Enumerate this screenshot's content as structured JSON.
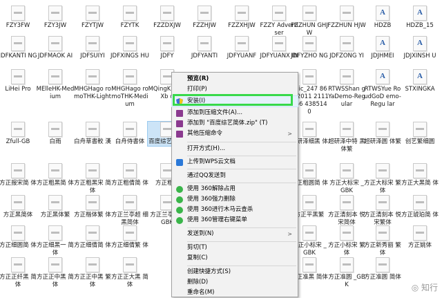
{
  "files_row1": [
    "FZY3FW",
    "FZY3JW",
    "FZYTJW",
    "FZYTK",
    "FZZDXJW",
    "FZZHJW",
    "FZZXHJW",
    "FZZY Advertiser",
    "FZZHUN GHJW",
    "FZZHUN HJW",
    "HDZB",
    "HDZB_15",
    ""
  ],
  "files_row2": [
    "JDFKANTI NG",
    "JDFMAOK AI",
    "JDFSUIYI",
    "JDFXINGS HU",
    "JDFY",
    "JDFYANTI",
    "JDFYUANF",
    "JDFYUANX IN",
    "JDFYZHO NG",
    "JDFZONG YI",
    "JDJHMEI",
    "JDJXINSH U",
    ""
  ],
  "files_row3": [
    "LiHei Pro",
    "MElleHK-Medium",
    "MHGHago romoTHK-Light",
    "MHGHago romoTHK-Medium",
    "MQingK aHK-Xb d",
    "",
    "",
    "",
    "lipic_247 863_2011 2111156 4385140",
    "RTWSShan gYaDemo-Regular",
    "RTWSYue RoudGoD emo-Regu lar",
    "STXINGKA",
    ""
  ],
  "files_row4": [
    "Zfull-GB",
    "白雨",
    "白舟草書較 漢",
    "白舟侍書体",
    "百度综艺简 体",
    "",
    "",
    "",
    "超研泽细黑 体",
    "超研泽中特 黑体繁",
    "超研泽圆 体繁",
    "创艺繁细圆",
    ""
  ],
  "files_row5": [
    "方正报宋简 体",
    "方正粗黑简 体",
    "方正粗黑宋 简体",
    "方正粗倩简 体",
    "方正粗谭",
    "",
    "",
    "",
    "方正粗圆简 体",
    "方正大标宋 _GBK",
    "方正大标宋 繁体",
    "方正大黑简 体",
    ""
  ],
  "files_row6": [
    "方正黑简体",
    "方正黑体繁",
    "方正楷体繁 体",
    "方正兰亭超 细黑简体",
    "方正兰亭黑 _GBK",
    "",
    "",
    "",
    "方正平黑繁",
    "方正清刻本 悦宋简体",
    "方正清刻本 悦宋繁体",
    "方正琥珀简 体",
    ""
  ],
  "files_row7": [
    "方正细圆简 体",
    "方正细黑一 简体",
    "方正细倩简 体",
    "方正细倩繁 体",
    "",
    "",
    "",
    "",
    "方正小标宋 _GBK",
    "方正小标宋 繁体",
    "方正新秀丽 繁体",
    "方正姚体",
    ""
  ],
  "files_row8": [
    "方正正纤黑 简体",
    "方正正中黑 简体",
    "方正正中黑 繁体",
    "方正正大黑 简体",
    "",
    "",
    "",
    "",
    "方正准黑 简体",
    "方正准圆 _GBK",
    "方正准圆 简体",
    "",
    ""
  ],
  "menu": {
    "preview": "预览(R)",
    "print": "打印(P)",
    "install": "安装(I)",
    "add_archive": "添加到压缩文件(A)...",
    "add_zip": "添加到 \"百度综艺简体.zip\" (T)",
    "other_compress": "其他压缩命令",
    "open_with": "打开方式(H)...",
    "upload_wps": "上传到WPS云文档",
    "send_qq": "通过QQ发送到",
    "unlock360": "使用 360解除占用",
    "delete360": "使用 360强力删除",
    "scan360": "使用 360进行木马云查杀",
    "menu360": "使用 360管理右键菜单",
    "send_to": "发送到(N)",
    "cut": "剪切(T)",
    "copy": "复制(C)",
    "shortcut": "创建快捷方式(S)",
    "delete": "删除(D)",
    "rename": "重命名(M)"
  },
  "watermark": "◎ 知行"
}
